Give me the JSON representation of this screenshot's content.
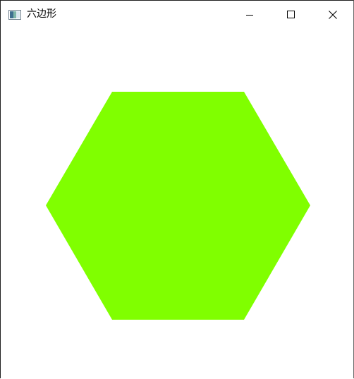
{
  "window": {
    "title": "六边形",
    "controls": {
      "minimize": "minimize-icon",
      "maximize": "maximize-icon",
      "close": "close-icon"
    }
  },
  "canvas": {
    "background": "#ffffff",
    "shape": {
      "type": "hexagon",
      "fill": "#80ff00"
    }
  }
}
